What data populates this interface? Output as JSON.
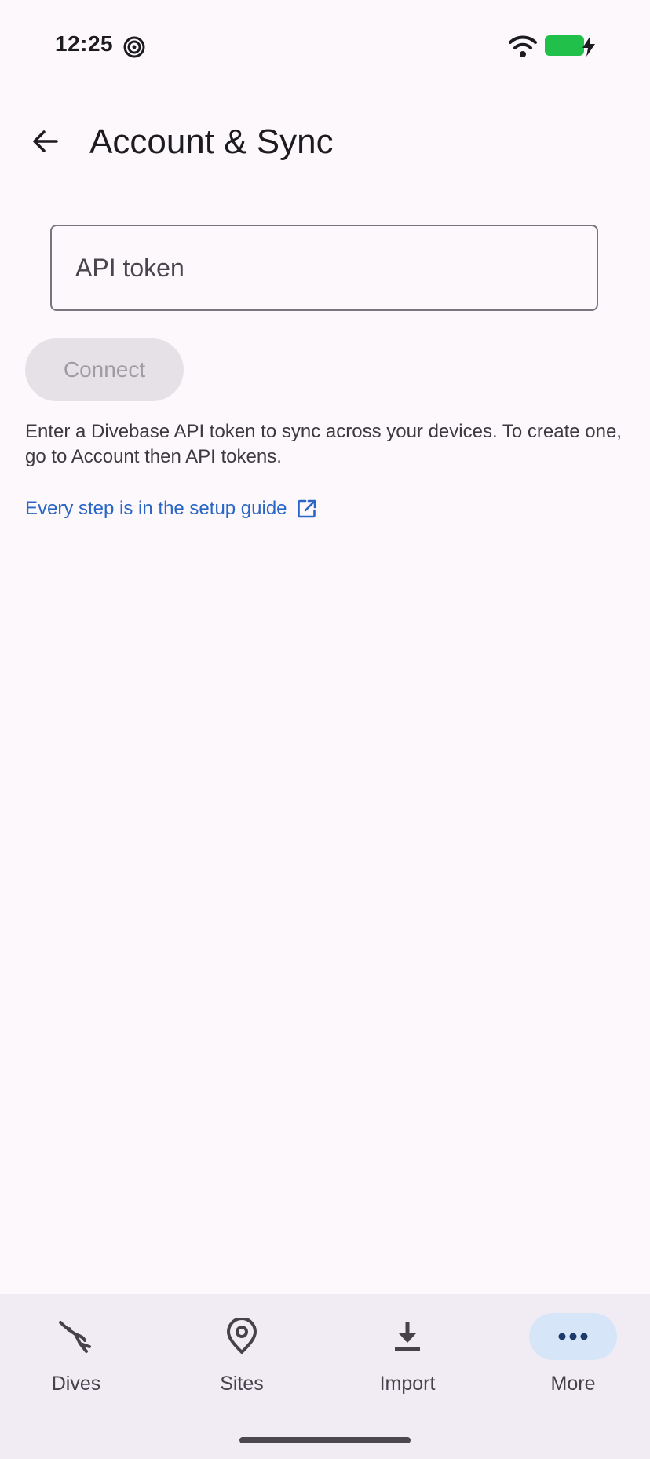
{
  "status_bar": {
    "time": "12:25",
    "icons": [
      "app-spiral-icon",
      "wifi-icon",
      "battery-charging-icon"
    ],
    "battery_color": "#21c04a"
  },
  "header": {
    "title": "Account & Sync",
    "back_icon": "arrow-back-icon"
  },
  "token_field": {
    "placeholder": "API token",
    "value": ""
  },
  "connect_button": {
    "label": "Connect",
    "enabled": false
  },
  "help_text": "Enter a Divebase API token to sync across your devices. To create one, go to Account then API tokens.",
  "guide_link": {
    "label": "Every step is in the setup guide",
    "icon": "open-in-new-icon",
    "color": "#2a66c6"
  },
  "bottom_nav": {
    "items": [
      {
        "label": "Dives",
        "icon": "diver-icon",
        "selected": false
      },
      {
        "label": "Sites",
        "icon": "location-pin-icon",
        "selected": false
      },
      {
        "label": "Import",
        "icon": "download-icon",
        "selected": false
      },
      {
        "label": "More",
        "icon": "more-horizontal-icon",
        "selected": true
      }
    ],
    "selected_indicator_color": "#d6e6f8"
  }
}
